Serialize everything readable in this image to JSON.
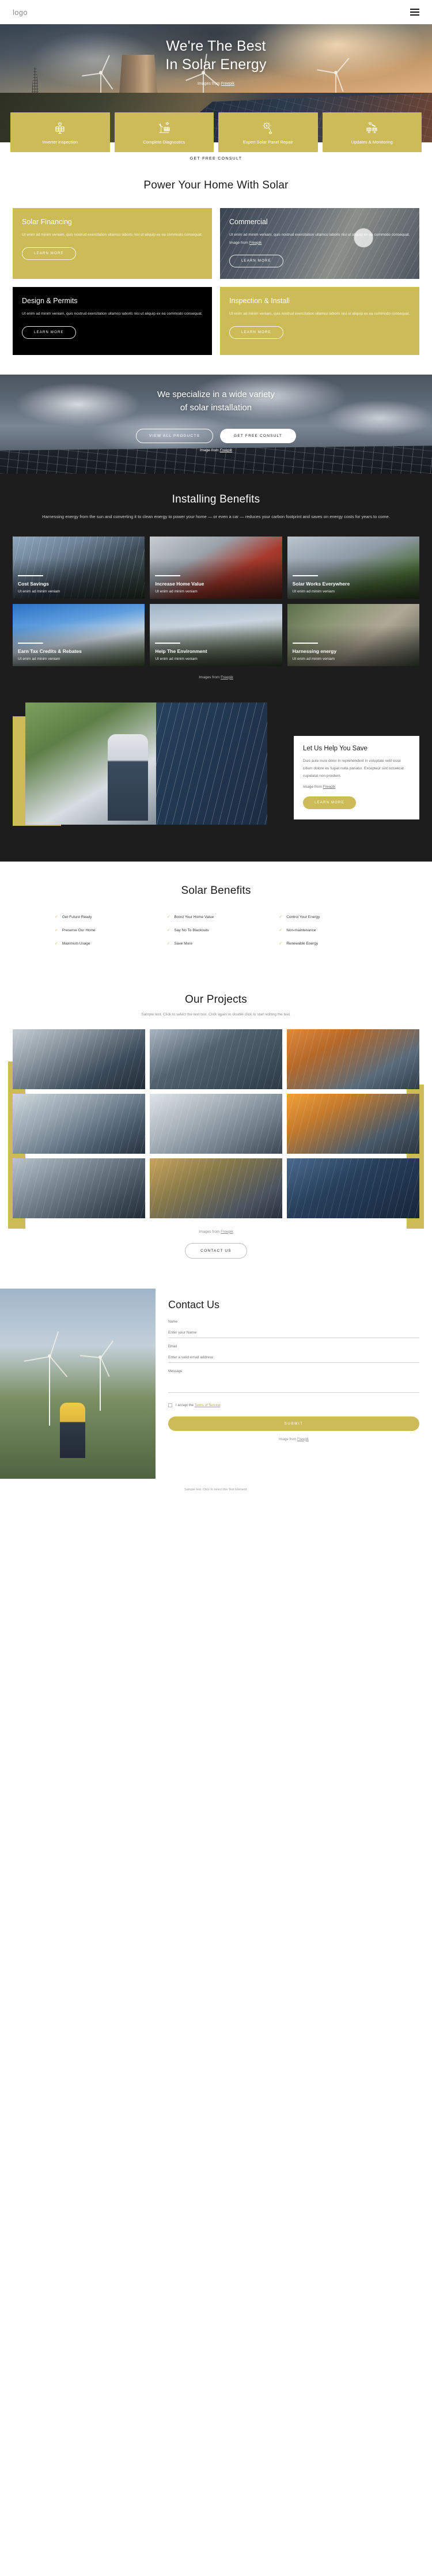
{
  "header": {
    "logo": "logo",
    "menu_icon": "hamburger-icon"
  },
  "hero": {
    "title_line1": "We're The Best",
    "title_line2": "In Solar Energy",
    "credit_prefix": "Images from ",
    "credit_link": "Freepik",
    "cta": "GET FREE CONSULT",
    "services": [
      {
        "label": "Inverter inspection",
        "icon": "solar-panel-sun-icon"
      },
      {
        "label": "Complete Diagnostics",
        "icon": "wind-turbine-panel-icon"
      },
      {
        "label": "Expert Solar Panel Repair",
        "icon": "gear-plug-icon"
      },
      {
        "label": "Updates & Monitoring",
        "icon": "sun-rays-panels-icon"
      }
    ]
  },
  "power": {
    "title": "Power Your Home With Solar",
    "body": "Ut enim ad minim veniam, quis nostrud exercitation ullamco laboris nisi ut aliquip ex ea commodo consequat.",
    "body_with_credit_prefix": "Ut enim ad minim veniam, quis nostrud exercitation ullamco laboris nisi ut aliquip ex ea commodo consequat. Image from ",
    "credit_link": "Freepik",
    "learn_more": "LEARN MORE",
    "cards": [
      {
        "title": "Solar Financing",
        "style": "gold"
      },
      {
        "title": "Commercial",
        "style": "photo-comm"
      },
      {
        "title": "Design & Permits",
        "style": "dark"
      },
      {
        "title": "Inspection & Install",
        "style": "photo-insp"
      }
    ]
  },
  "specialize": {
    "title_line1": "We specialize in a wide variety",
    "title_line2": "of solar installation",
    "btn_ghost": "VIEW ALL PRODUCTS",
    "btn_solid": "GET FREE CONSULT",
    "credit_prefix": "Image from ",
    "credit_link": "Freepik"
  },
  "benefits": {
    "title": "Installing Benefits",
    "subtitle": "Harnessing energy from the sun and converting it to clean energy to power your home — or even a car — reduces your carbon footprint and saves on energy costs for years to come.",
    "item_sub": "Ut enim ad minim veniam",
    "credit_prefix": "Images from ",
    "credit_link": "Freepik",
    "tiles": [
      {
        "title": "Cost Savings",
        "bg": "bg-a"
      },
      {
        "title": "Increase Home Value",
        "bg": "bg-b"
      },
      {
        "title": "Solar Works Everywhere",
        "bg": "bg-c"
      },
      {
        "title": "Earn Tax Credits & Rebates",
        "bg": "bg-d"
      },
      {
        "title": "Help The Environment",
        "bg": "bg-e"
      },
      {
        "title": "Harnessing energy",
        "bg": "bg-f"
      }
    ]
  },
  "save": {
    "title": "Let Us Help You Save",
    "body": "Duis aute irure dolor in reprehenderit in voluptate velit esse cillum dolore eu fugiat nulla pariatur. Excepteur sint occaecat cupidatat non proident.",
    "credit_prefix": "Image from ",
    "credit_link": "Freepik",
    "learn_more": "LEARN MORE"
  },
  "solar_benefits": {
    "title": "Solar Benefits",
    "items": [
      "Get Future Ready",
      "Boost Your Home Value",
      "Control Your Energy",
      "Preserve Our Home",
      "Say No To Blackouts",
      "Non-maintenance",
      "Maximum Usage",
      "Save More",
      "Renewable Energy"
    ]
  },
  "projects": {
    "title": "Our Projects",
    "subtitle": "Sample text. Click to select the text box. Click again or double click to start editing the text.",
    "credit_prefix": "Images from ",
    "credit_link": "Freepik",
    "contact_btn": "CONTACT US"
  },
  "contact": {
    "title": "Contact Us",
    "fields": [
      {
        "label": "Name",
        "placeholder": "Enter your Name",
        "value": ""
      },
      {
        "label": "Email",
        "placeholder": "Enter a valid email address",
        "value": ""
      },
      {
        "label": "Message",
        "placeholder": "",
        "value": ""
      }
    ],
    "consent_prefix": "I accept the ",
    "consent_link": "Terms of Service",
    "submit": "SUBMIT",
    "credit_prefix": "Image from ",
    "credit_link": "Freepik"
  },
  "footer": {
    "text": "Sample text. Click to select the Text Element."
  },
  "colors": {
    "accent": "#ccbb56",
    "dark": "#1d1d1d",
    "white": "#ffffff"
  }
}
